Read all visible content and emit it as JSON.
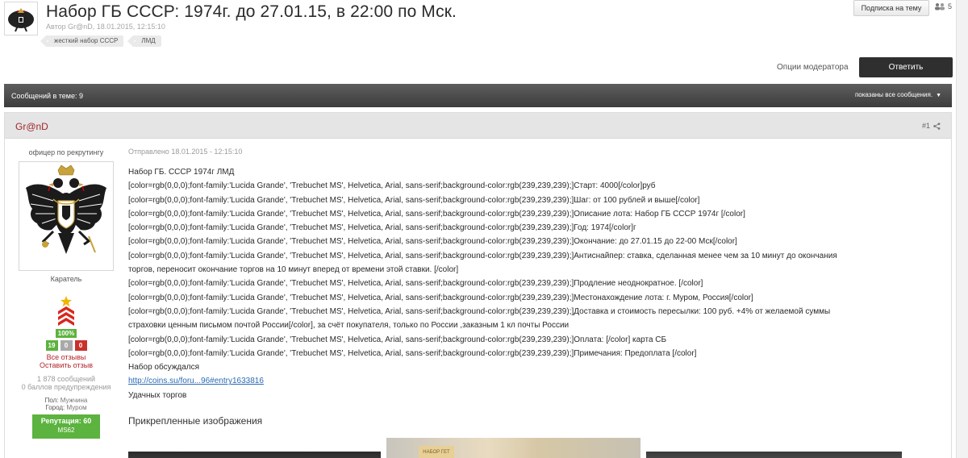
{
  "topic": {
    "title": "Набор ГБ СССР: 1974г. до 27.01.15, в 22:00 по Мск.",
    "meta": "Автор Gr@nD, 18.01.2015, 12:15:10",
    "tags": [
      "жесткий набор СССР",
      "ЛМД"
    ],
    "follow_label": "Подписка на тему",
    "followers_count": "5"
  },
  "actions": {
    "mod_options": "Опции модератора",
    "reply": "Ответить"
  },
  "bar": {
    "count": "Сообщений в теме: 9",
    "shown": "показаны все сообщения.",
    "shown_arrow": "▼"
  },
  "post": {
    "author": "Gr@nD",
    "number": "#1",
    "date": "Отправлено 18.01.2015 - 12:15:10",
    "lines": [
      "Набор ГБ. СССР  1974г  ЛМД",
      "[color=rgb(0,0,0);font-family:'Lucida Grande', 'Trebuchet MS', Helvetica, Arial, sans-serif;background-color:rgb(239,239,239);]Старт: 4000[/color]руб",
      "[color=rgb(0,0,0);font-family:'Lucida Grande', 'Trebuchet MS', Helvetica, Arial, sans-serif;background-color:rgb(239,239,239);]Шаг: от 100 рублей и выше[/color]",
      "[color=rgb(0,0,0);font-family:'Lucida Grande', 'Trebuchet MS', Helvetica, Arial, sans-serif;background-color:rgb(239,239,239);]Описание лота: Набор ГБ СССР  1974г  [/color]",
      "[color=rgb(0,0,0);font-family:'Lucida Grande', 'Trebuchet MS', Helvetica, Arial, sans-serif;background-color:rgb(239,239,239);]Год: 1974[/color]г",
      "[color=rgb(0,0,0);font-family:'Lucida Grande', 'Trebuchet MS', Helvetica, Arial, sans-serif;background-color:rgb(239,239,239);]Окончание: до 27.01.15 до 22-00 Мск[/color]",
      "[color=rgb(0,0,0);font-family:'Lucida Grande', 'Trebuchet MS', Helvetica, Arial, sans-serif;background-color:rgb(239,239,239);]Антиснайпер: ставка, сделанная менее чем за 10 минут до окончания",
      "торгов, переносит окончание торгов на 10 минут вперед от времени этой ставки. [/color]",
      "[color=rgb(0,0,0);font-family:'Lucida Grande', 'Trebuchet MS', Helvetica, Arial, sans-serif;background-color:rgb(239,239,239);]Продление неоднократное. [/color]",
      "[color=rgb(0,0,0);font-family:'Lucida Grande', 'Trebuchet MS', Helvetica, Arial, sans-serif;background-color:rgb(239,239,239);]Местонахождение лота: г. Муром, Россия[/color]",
      "[color=rgb(0,0,0);font-family:'Lucida Grande', 'Trebuchet MS', Helvetica, Arial, sans-serif;background-color:rgb(239,239,239);]Доставка и стоимость пересылки: 100 руб. +4% от желаемой суммы",
      "страховки ценным письмом почтой России[/color], за счёт покупателя, только по России ,заказным 1 кл почты России",
      "[color=rgb(0,0,0);font-family:'Lucida Grande', 'Trebuchet MS', Helvetica, Arial, sans-serif;background-color:rgb(239,239,239);]Оплата: [/color] карта СБ",
      "[color=rgb(0,0,0);font-family:'Lucida Grande', 'Trebuchet MS', Helvetica, Arial, sans-serif;background-color:rgb(239,239,239);]Примечания: Предоплата [/color]",
      "Набор обсуждался"
    ],
    "link": "http://coins.su/foru...96#entry1633816",
    "closing": "Удачных  торгов",
    "attachments_title": "Прикрепленные изображения",
    "attachment_plate": "НАБОР ГЕТ"
  },
  "author_panel": {
    "title": "офицер по рекрутингу",
    "group": "Каратель",
    "percent": "100%",
    "votes": [
      "19",
      "0",
      "0"
    ],
    "all_reviews": "Все отзывы",
    "leave_review": "Оставить отзыв",
    "posts": "1 878 сообщений",
    "warnings": "0 баллов предупреждения",
    "gender_key": "Пол:",
    "gender_val": "Мужчина",
    "city_key": "Город:",
    "city_val": "Муром",
    "reputation": "Репутация: 60",
    "rep_grade": "MS62"
  },
  "colors": {
    "accent_dark": "#2f2f2f",
    "author_red": "#a0262c",
    "badge_green": "#5cb33f",
    "link_blue": "#2a6bb3"
  }
}
